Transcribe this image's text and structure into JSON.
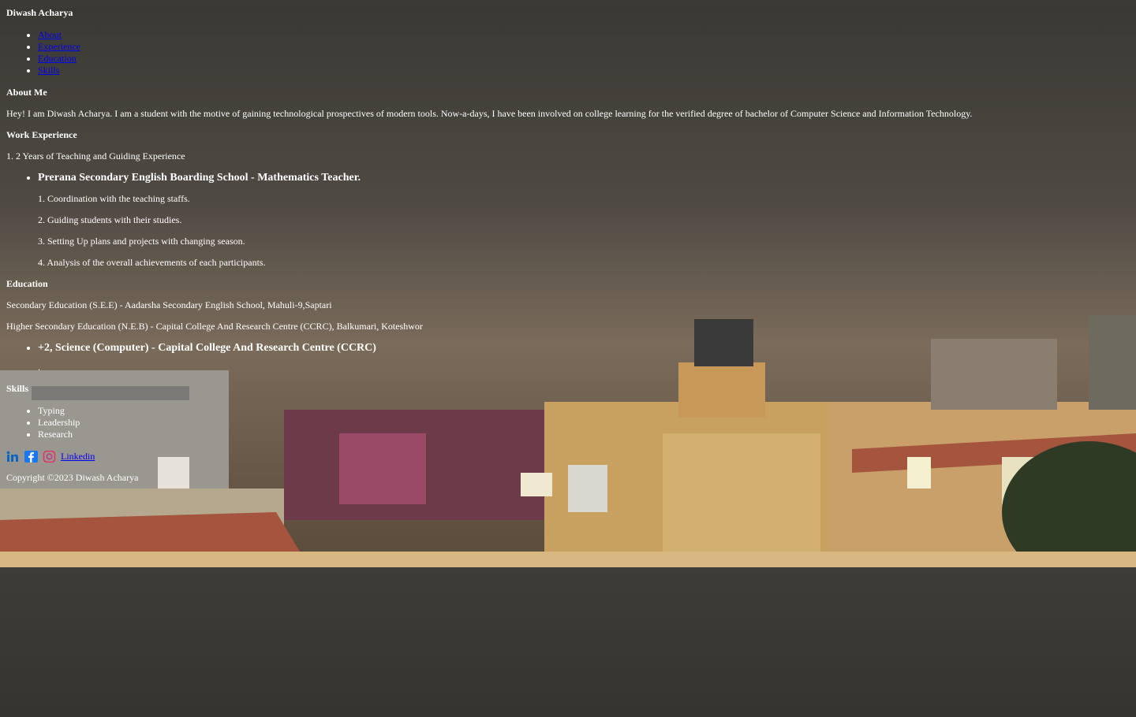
{
  "header": {
    "name": "Diwash Acharya"
  },
  "nav": [
    {
      "label": "About"
    },
    {
      "label": "Experience"
    },
    {
      "label": "Education"
    },
    {
      "label": "Skills"
    }
  ],
  "about": {
    "title": "About Me",
    "text": "Hey! I am Diwash Acharya. I am a student with the motive of gaining technological prospectives of modern tools. Now-a-days, I have been involved on college learning for the verified degree of bachelor of Computer Science and Information Technology."
  },
  "experience": {
    "title": "Work Experience",
    "summary": "1. 2 Years of Teaching and Guiding Experience",
    "job_title": "Prerana Secondary English Boarding School - Mathematics Teacher.",
    "duties": [
      "1. Coordination with the teaching staffs.",
      "2. Guiding students with their studies.",
      "3. Setting Up plans and projects with changing season.",
      "4. Analysis of the overall achievements of each participants."
    ]
  },
  "education": {
    "title": "Education",
    "items": [
      "Secondary Education (S.E.E) - Aadarsha Secondary English School, Mahuli-9,Saptari",
      "Higher Secondary Education (N.E.B) - Capital College And Research Centre (CCRC), Balkumari, Koteshwor"
    ],
    "program_title": "+2, Science (Computer) - Capital College And Research Centre (CCRC)",
    "program_note": "."
  },
  "skills": {
    "title": "Skills",
    "items": [
      "Typing",
      "Leadership",
      "Research"
    ]
  },
  "social": {
    "icons": [
      "linkedin-icon",
      "facebook-icon",
      "instagram-icon"
    ],
    "link_label": "Linkedin"
  },
  "footer": {
    "copyright": "Copyright ©2023 Diwash Acharya"
  },
  "colors": {
    "link": "#0000ee",
    "text": "#ffffff",
    "linkedin": "#0a66c2",
    "facebook": "#1877f2",
    "instagram": "#e1306c"
  }
}
